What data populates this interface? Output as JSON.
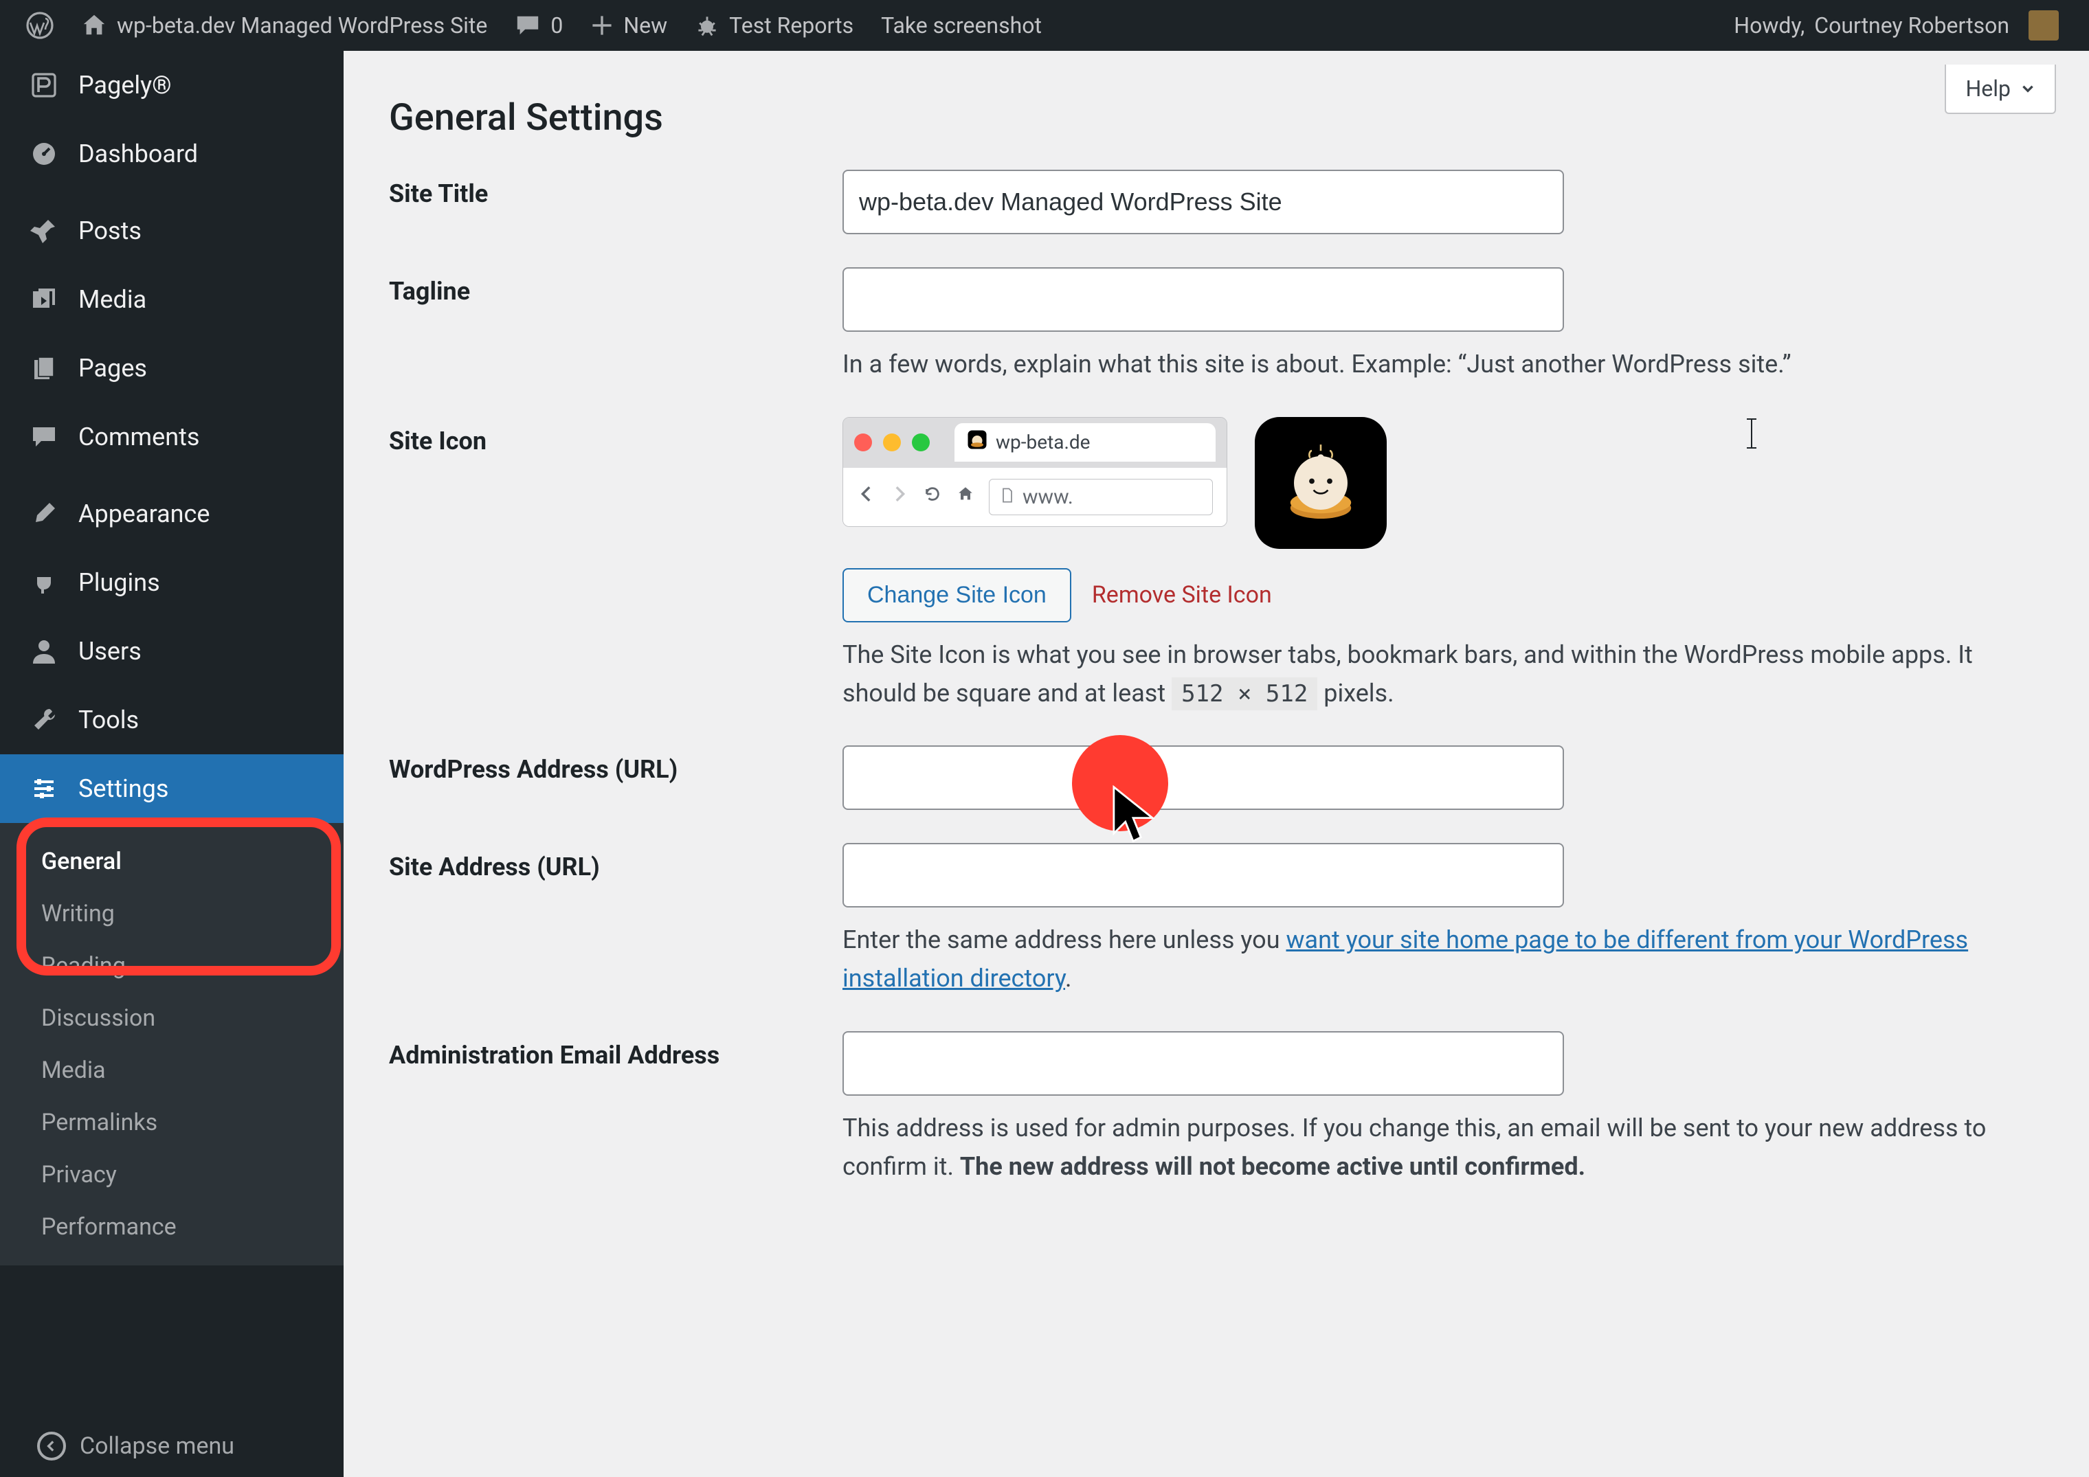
{
  "adminbar": {
    "site_title": "wp-beta.dev Managed WordPress Site",
    "comments_count": "0",
    "new_label": "New",
    "extra_items": [
      "Test Reports",
      "Take screenshot"
    ],
    "howdy_prefix": "Howdy, ",
    "user_name": "Courtney Robertson"
  },
  "sidebar": {
    "items": [
      {
        "id": "pagely",
        "label": "Pagely®",
        "icon": "pagely"
      },
      {
        "id": "dashboard",
        "label": "Dashboard",
        "icon": "gauge"
      },
      {
        "id": "posts",
        "label": "Posts",
        "icon": "pin"
      },
      {
        "id": "media",
        "label": "Media",
        "icon": "media"
      },
      {
        "id": "pages",
        "label": "Pages",
        "icon": "page"
      },
      {
        "id": "comments",
        "label": "Comments",
        "icon": "comment"
      },
      {
        "id": "appearance",
        "label": "Appearance",
        "icon": "brush"
      },
      {
        "id": "plugins",
        "label": "Plugins",
        "icon": "plug"
      },
      {
        "id": "users",
        "label": "Users",
        "icon": "user"
      },
      {
        "id": "tools",
        "label": "Tools",
        "icon": "wrench"
      },
      {
        "id": "settings",
        "label": "Settings",
        "icon": "sliders"
      }
    ],
    "settings_submenu": [
      "General",
      "Writing",
      "Reading",
      "Discussion",
      "Media",
      "Permalinks",
      "Privacy",
      "Performance"
    ],
    "collapse_label": "Collapse menu"
  },
  "help_label": "Help",
  "page_heading": "General Settings",
  "form": {
    "site_title": {
      "label": "Site Title",
      "value": "wp-beta.dev Managed WordPress Site"
    },
    "tagline": {
      "label": "Tagline",
      "value": "",
      "desc": "In a few words, explain what this site is about. Example: “Just another WordPress site.”"
    },
    "site_icon": {
      "label": "Site Icon",
      "preview_tab_text": "wp-beta.de",
      "preview_url_text": "www.",
      "change_btn": "Change Site Icon",
      "remove_link": "Remove Site Icon",
      "desc_before": "The Site Icon is what you see in browser tabs, bookmark bars, and within the WordPress mobile apps. It should be square and at least ",
      "desc_code": "512 × 512",
      "desc_after": " pixels."
    },
    "wp_url": {
      "label": "WordPress Address (URL)",
      "value": ""
    },
    "site_url": {
      "label": "Site Address (URL)",
      "value": "",
      "desc_before": "Enter the same address here unless you ",
      "desc_link": "want your site home page to be different from your WordPress installation directory",
      "desc_after": "."
    },
    "admin_email": {
      "label": "Administration Email Address",
      "value": "",
      "desc_plain": "This address is used for admin purposes. If you change this, an email will be sent to your new address to confirm it. ",
      "desc_bold": "The new address will not become active until confirmed."
    }
  }
}
